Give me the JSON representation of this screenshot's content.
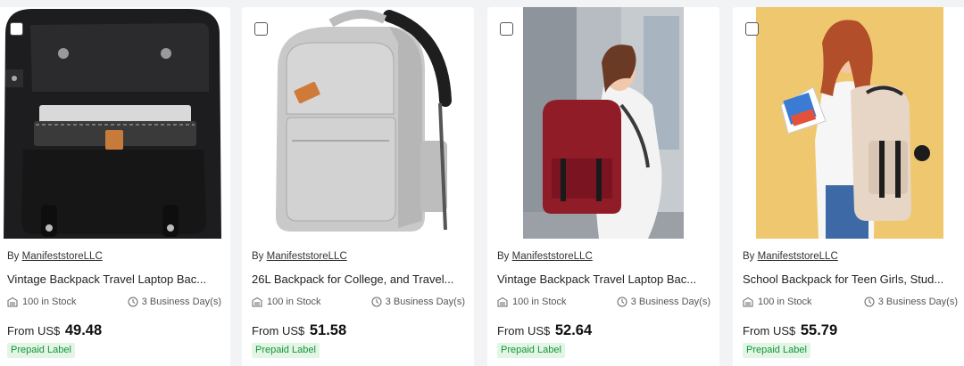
{
  "products": [
    {
      "by_prefix": "By",
      "seller": "ManifeststoreLLC",
      "title": "Vintage Backpack Travel Laptop Bac...",
      "stock": "100 in Stock",
      "shipping": "3 Business Day(s)",
      "price_prefix": "From US$",
      "price": "49.48",
      "badge": "Prepaid Label",
      "image_icon": "black-laptop-backpack-photo"
    },
    {
      "by_prefix": "By",
      "seller": "ManifeststoreLLC",
      "title": "26L Backpack for College, and Travel...",
      "stock": "100 in Stock",
      "shipping": "3 Business Day(s)",
      "price_prefix": "From US$",
      "price": "51.58",
      "badge": "Prepaid Label",
      "image_icon": "gray-backpack-photo"
    },
    {
      "by_prefix": "By",
      "seller": "ManifeststoreLLC",
      "title": "Vintage Backpack Travel Laptop Bac...",
      "stock": "100 in Stock",
      "shipping": "3 Business Day(s)",
      "price_prefix": "From US$",
      "price": "52.64",
      "badge": "Prepaid Label",
      "image_icon": "woman-with-red-backpack-photo"
    },
    {
      "by_prefix": "By",
      "seller": "ManifeststoreLLC",
      "title": "School Backpack for Teen Girls, Stud...",
      "stock": "100 in Stock",
      "shipping": "3 Business Day(s)",
      "price_prefix": "From US$",
      "price": "55.79",
      "badge": "Prepaid Label",
      "image_icon": "girl-with-beige-backpack-photo"
    }
  ],
  "colors": {
    "page_bg": "#f2f3f5",
    "card_bg": "#ffffff",
    "badge_bg": "#e3f6e6",
    "badge_text": "#14953a"
  }
}
